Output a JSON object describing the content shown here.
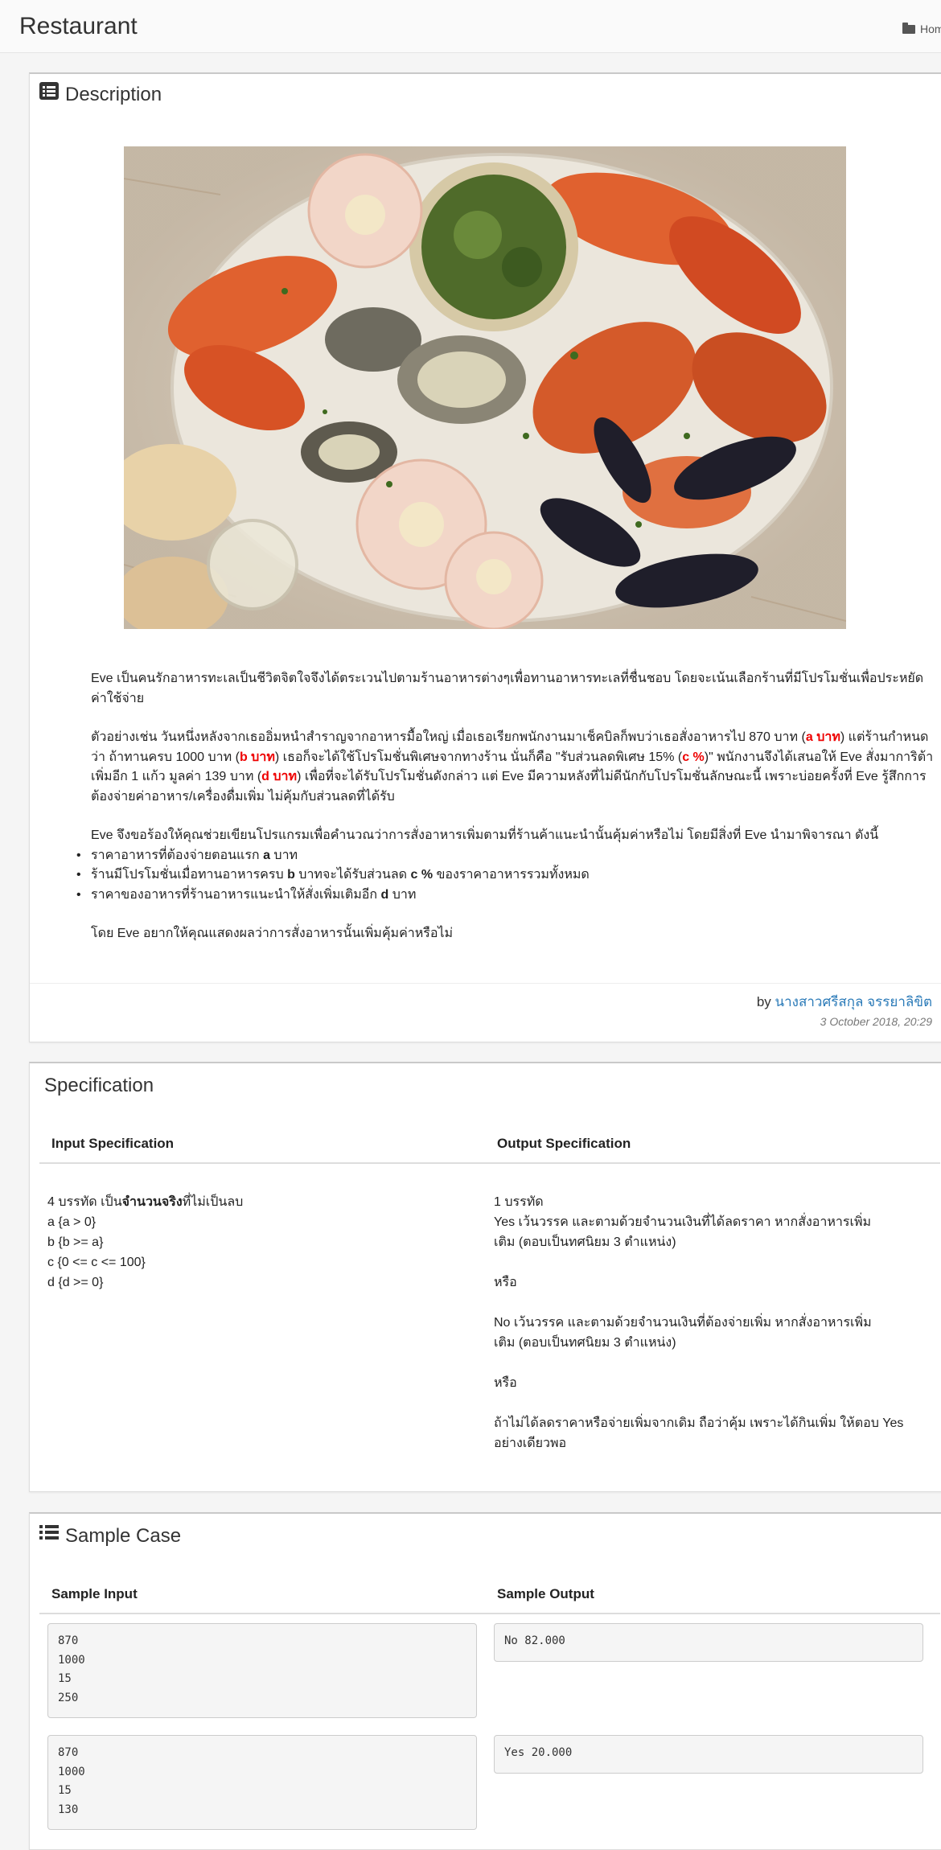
{
  "header": {
    "title": "Restaurant",
    "breadcrumb": "Home"
  },
  "description": {
    "heading": "Description",
    "paragraph1": "Eve เป็นคนรักอาหารทะเลเป็นชีวิตจิตใจจึงได้ตระเวนไปตามร้านอาหารต่างๆเพื่อทานอาหารทะเลที่ชื่นชอบ โดยจะเน้นเลือกร้านที่มีโปรโมชั่นเพื่อประหยัดค่าใช้จ่าย",
    "p2_a": "ตัวอย่างเช่น วันหนึ่งหลังจากเธออิ่มหนำสำราญจากอาหารมื้อใหญ่ เมื่อเธอเรียกพนักงานมาเช็คบิลก็พบว่าเธอสั่งอาหารไป 870 บาท (",
    "p2_red_a": "a บาท",
    "p2_b": ") แต่ร้านกำหนดว่า ถ้าทานครบ 1000 บาท (",
    "p2_red_b": "b บาท",
    "p2_c": ") เธอก็จะได้ใช้โปรโมชั่นพิเศษจากทางร้าน นั่นก็คือ \"รับส่วนลดพิเศษ 15% (",
    "p2_red_c": "c %",
    "p2_d": ")\" พนักงานจึงได้เสนอให้ Eve สั่งมาการิต้าเพิ่มอีก 1 แก้ว มูลค่า 139 บาท (",
    "p2_red_d": "d บาท",
    "p2_e": ") เพื่อที่จะได้รับโปรโมชั่นดังกล่าว แต่ Eve มีความหลังที่ไม่ดีนักกับโปรโมชั่นลักษณะนี้ เพราะบ่อยครั้งที่ Eve รู้สึกการต้องจ่ายค่าอาหาร/เครื่องดื่มเพิ่ม ไม่คุ้มกับส่วนลดที่ได้รับ",
    "paragraph3": "Eve จึงขอร้องให้คุณช่วยเขียนโปรแกรมเพื่อคำนวณว่าการสั่งอาหารเพิ่มตามที่ร้านค้าแนะนำนั้นคุ้มค่าหรือไม่ โดยมีสิ่งที่ Eve นำมาพิจารณา ดังนี้",
    "bullet1_pre": "ราคาอาหารที่ต้องจ่ายตอนแรก ",
    "bullet1_bold": "a",
    "bullet1_post": " บาท",
    "bullet2_pre": "ร้านมีโปรโมชั่นเมื่อทานอาหารครบ ",
    "bullet2_bold": "b",
    "bullet2_mid": " บาทจะได้รับส่วนลด ",
    "bullet2_bold2": "c %",
    "bullet2_post": " ของราคาอาหารรวมทั้งหมด",
    "bullet3_pre": "ราคาของอาหารที่ร้านอาหารแนะนำให้สั่งเพิ่มเติมอีก ",
    "bullet3_bold": "d",
    "bullet3_post": " บาท",
    "paragraph4": "โดย Eve อยากให้คุณแสดงผลว่าการสั่งอาหารนั้นเพิ่มคุ้มค่าหรือไม่",
    "by_label": "by",
    "author": "นางสาวศรีสกุล จรรยาลิขิต",
    "date": "3 October 2018, 20:29"
  },
  "specification": {
    "heading": "Specification",
    "input_header": "Input Specification",
    "output_header": "Output Specification",
    "input_line1_pre": "4 บรรทัด เป็น",
    "input_line1_bold": "จำนวนจริง",
    "input_line1_post": "ที่ไม่เป็นลบ",
    "input_lines": [
      "a {a > 0}",
      "b {b >= a}",
      "c {0 <= c <= 100}",
      "d {d >= 0}"
    ],
    "output_line1": "1 บรรทัด",
    "output_yes_1": "Yes เว้นวรรค และตามด้วยจำนวนเงินที่ได้ลดราคา หากสั่งอาหารเพิ่ม",
    "output_yes_2": "เติม (ตอบเป็นทศนิยม 3 ตำแหน่ง)",
    "output_or1": "หรือ",
    "output_no_1": "No เว้นวรรค และตามด้วยจำนวนเงินที่ต้องจ่ายเพิ่ม หากสั่งอาหารเพิ่ม",
    "output_no_2": "เติม (ตอบเป็นทศนิยม 3 ตำแหน่ง)",
    "output_or2": "หรือ",
    "output_last_1": "ถ้าไม่ได้ลดราคาหรือจ่ายเพิ่มจากเดิม ถือว่าคุ้ม เพราะได้กินเพิ่ม ให้ตอบ Yes",
    "output_last_2": "อย่างเดียวพอ"
  },
  "sample_case": {
    "heading": "Sample Case",
    "input_header": "Sample Input",
    "output_header": "Sample Output",
    "cases": [
      {
        "input": "870\n1000\n15\n250",
        "output": "No 82.000"
      },
      {
        "input": "870\n1000\n15\n130",
        "output": "Yes 20.000"
      }
    ]
  }
}
